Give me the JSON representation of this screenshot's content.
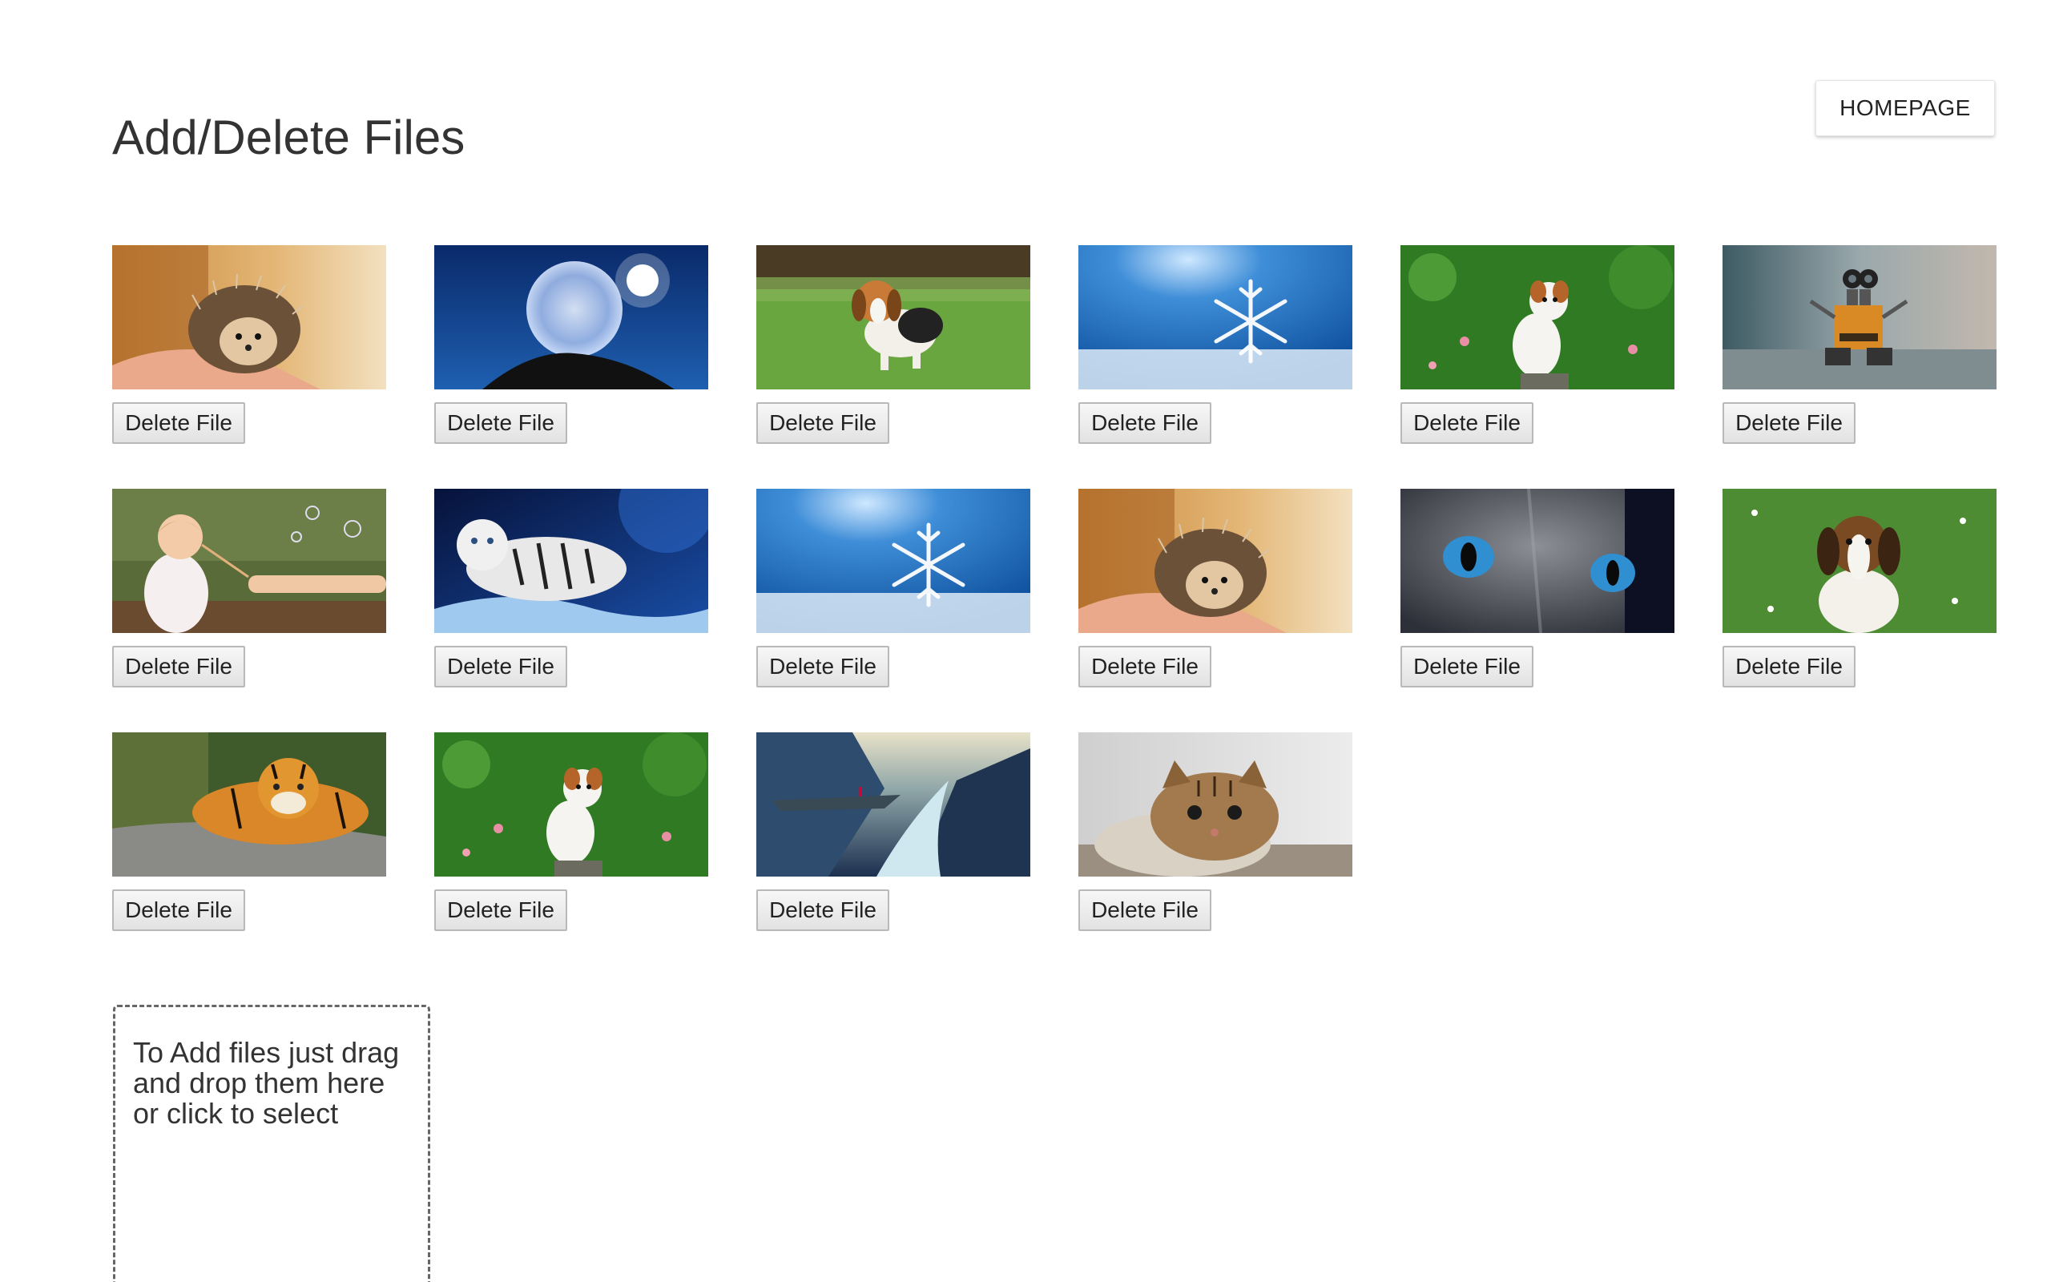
{
  "page": {
    "title": "Add/Delete Files",
    "homepage_label": "HOMEPAGE"
  },
  "files": [
    {
      "image": "hedgehog-icon",
      "delete_label": "Delete File"
    },
    {
      "image": "bubble-moon-icon",
      "delete_label": "Delete File"
    },
    {
      "image": "beagle-puppy-running-icon",
      "delete_label": "Delete File"
    },
    {
      "image": "snowflake-icon",
      "delete_label": "Delete File"
    },
    {
      "image": "puppy-on-grass-icon",
      "delete_label": "Delete File"
    },
    {
      "image": "wall-e-robot-icon",
      "delete_label": "Delete File"
    },
    {
      "image": "girl-blowing-bubbles-icon",
      "delete_label": "Delete File"
    },
    {
      "image": "white-tiger-icon",
      "delete_label": "Delete File"
    },
    {
      "image": "snowflake-icon",
      "delete_label": "Delete File"
    },
    {
      "image": "hedgehog-icon",
      "delete_label": "Delete File"
    },
    {
      "image": "cat-blue-eyes-icon",
      "delete_label": "Delete File"
    },
    {
      "image": "beagle-puppy-sitting-icon",
      "delete_label": "Delete File"
    },
    {
      "image": "tiger-icon",
      "delete_label": "Delete File"
    },
    {
      "image": "puppy-on-grass-icon",
      "delete_label": "Delete File"
    },
    {
      "image": "fjord-landscape-icon",
      "delete_label": "Delete File"
    },
    {
      "image": "kitten-icon",
      "delete_label": "Delete File"
    }
  ],
  "dropzone": {
    "text": "To Add files just drag and drop them here or click to select"
  }
}
